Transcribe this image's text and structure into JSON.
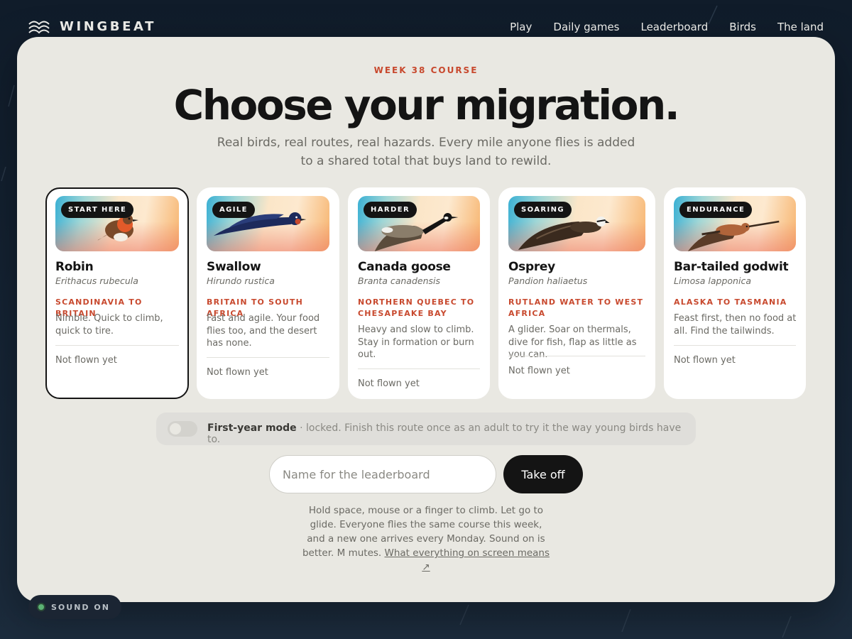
{
  "app": {
    "brand": "WINGBEAT",
    "nav": [
      "Play",
      "Daily games",
      "Leaderboard",
      "Birds",
      "The land"
    ]
  },
  "hero": {
    "eyebrow": "WEEK 38 COURSE",
    "title": "Choose your migration.",
    "subtitle": "Real birds, real routes, real hazards. Every mile anyone flies is added to a shared total that buys land to rewild."
  },
  "birds": [
    {
      "tag": "START HERE",
      "name": "Robin",
      "latin": "Erithacus rubecula",
      "route": "SCANDINAVIA TO BRITAIN",
      "description": "Nimble. Quick to climb, quick to tire.",
      "status": "Not flown yet",
      "selected": true
    },
    {
      "tag": "AGILE",
      "name": "Swallow",
      "latin": "Hirundo rustica",
      "route": "BRITAIN TO SOUTH AFRICA",
      "description": "Fast and agile. Your food flies too, and the desert has none.",
      "status": "Not flown yet",
      "selected": false
    },
    {
      "tag": "HARDER",
      "name": "Canada goose",
      "latin": "Branta canadensis",
      "route": "NORTHERN QUEBEC TO CHESAPEAKE BAY",
      "description": "Heavy and slow to climb. Stay in formation or burn out.",
      "status": "Not flown yet",
      "selected": false
    },
    {
      "tag": "SOARING",
      "name": "Osprey",
      "latin": "Pandion haliaetus",
      "route": "RUTLAND WATER TO WEST AFRICA",
      "description": "A glider. Soar on thermals, dive for fish, flap as little as you can.",
      "status": "Not flown yet",
      "selected": false
    },
    {
      "tag": "ENDURANCE",
      "name": "Bar-tailed godwit",
      "latin": "Limosa lapponica",
      "route": "ALASKA TO TASMANIA",
      "description": "Feast first, then no food at all. Find the tailwinds.",
      "status": "Not flown yet",
      "selected": false
    }
  ],
  "first_year": {
    "label": "First-year mode",
    "note": " · locked. Finish this route once as an adult to try it the way young birds have to.",
    "enabled": false
  },
  "form": {
    "name_placeholder": "Name for the leaderboard",
    "submit_label": "Take off"
  },
  "help": {
    "text": "Hold space, mouse or a finger to climb. Let go to glide. Everyone flies the same course this week, and a new one arrives every Monday. Sound on is better. M mutes.",
    "link": "What everything on screen means ↗"
  },
  "sound": {
    "label": "SOUND ON"
  },
  "colors": {
    "accent": "#c8492e",
    "panel": "#e9e8e2",
    "ink": "#141414",
    "sound_on": "#5cb374"
  }
}
